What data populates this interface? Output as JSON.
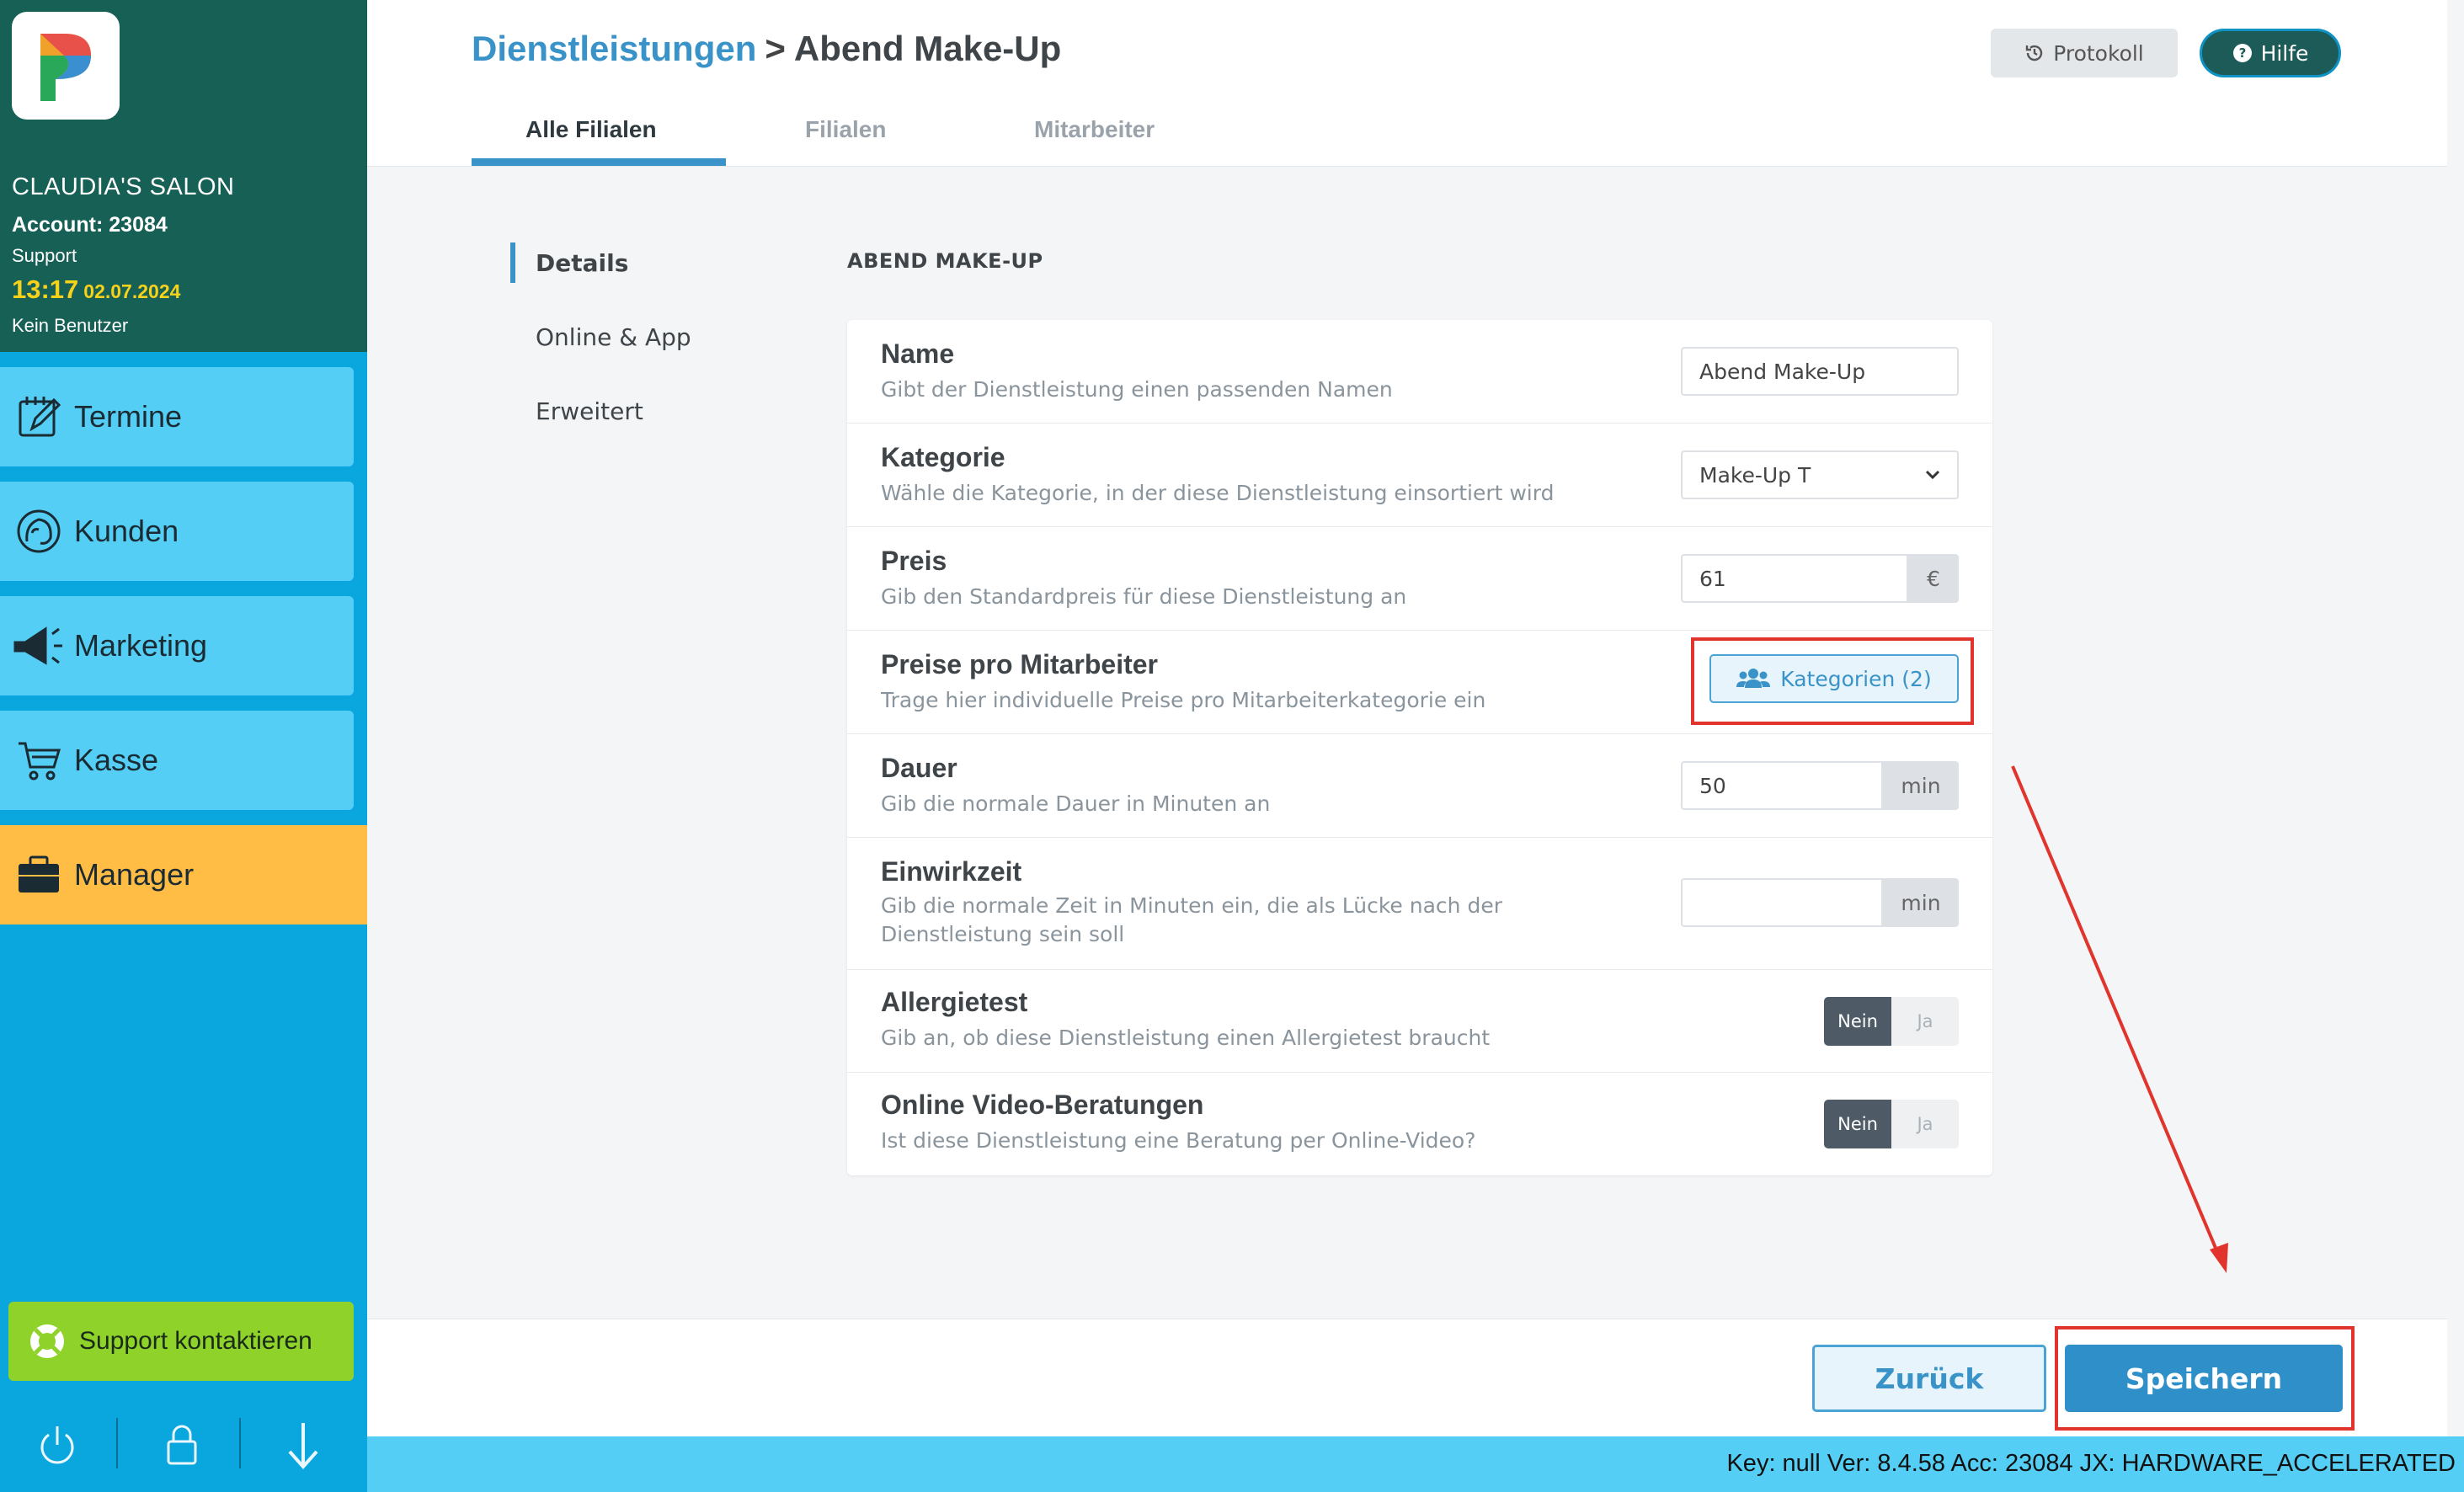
{
  "sidebar": {
    "salon_name": "CLAUDIA'S SALON",
    "account": "Account: 23084",
    "role": "Support",
    "time": "13:17",
    "date": "02.07.2024",
    "user": "Kein Benutzer",
    "nav": [
      {
        "label": "Termine",
        "icon": "calendar-edit-icon"
      },
      {
        "label": "Kunden",
        "icon": "customer-head-icon"
      },
      {
        "label": "Marketing",
        "icon": "megaphone-icon"
      },
      {
        "label": "Kasse",
        "icon": "cart-icon"
      },
      {
        "label": "Manager",
        "icon": "briefcase-icon"
      }
    ],
    "support_label": "Support kontaktieren",
    "bottom_icons": [
      "power-icon",
      "lock-icon",
      "arrow-down-icon"
    ]
  },
  "header": {
    "breadcrumb_link": "Dienstleistungen",
    "breadcrumb_sep": ">",
    "breadcrumb_current": "Abend Make-Up",
    "protokoll_label": "Protokoll",
    "hilfe_label": "Hilfe",
    "tabs": [
      "Alle Filialen",
      "Filialen",
      "Mitarbeiter"
    ]
  },
  "side_menu": [
    "Details",
    "Online & App",
    "Erweitert"
  ],
  "section_title": "ABEND MAKE-UP",
  "form": {
    "name": {
      "label": "Name",
      "desc": "Gibt der Dienstleistung einen passenden Namen",
      "value": "Abend Make-Up"
    },
    "kategorie": {
      "label": "Kategorie",
      "desc": "Wähle die Kategorie, in der diese Dienstleistung einsortiert wird",
      "value": "Make-Up T"
    },
    "preis": {
      "label": "Preis",
      "desc": "Gib den Standardpreis für diese Dienstleistung an",
      "value": "61",
      "unit": "€"
    },
    "preise_mitarbeiter": {
      "label": "Preise pro Mitarbeiter",
      "desc": "Trage hier individuelle Preise pro Mitarbeiterkategorie ein",
      "button": "Kategorien (2)"
    },
    "dauer": {
      "label": "Dauer",
      "desc": "Gib die normale Dauer in Minuten an",
      "value": "50",
      "unit": "min"
    },
    "einwirkzeit": {
      "label": "Einwirkzeit",
      "desc": "Gib die normale Zeit in Minuten ein, die als Lücke nach der Dienstleistung sein soll",
      "value": "",
      "unit": "min"
    },
    "allergietest": {
      "label": "Allergietest",
      "desc": "Gib an, ob diese Dienstleistung einen Allergietest braucht",
      "no": "Nein",
      "yes": "Ja",
      "selected": "Nein"
    },
    "video": {
      "label": "Online Video-Beratungen",
      "desc": "Ist diese Dienstleistung eine Beratung per Online-Video?",
      "no": "Nein",
      "yes": "Ja",
      "selected": "Nein"
    }
  },
  "footer": {
    "back_label": "Zurück",
    "save_label": "Speichern"
  },
  "status_bar": "Key: null Ver: 8.4.58 Acc: 23084  JX: HARDWARE_ACCELERATED",
  "colors": {
    "sidebar_top": "#176056",
    "sidebar": "#0aa6de",
    "nav_item": "#54cef4",
    "active_nav": "#ffbd45",
    "accent": "#3a93c8",
    "annotation": "#e0342c"
  }
}
